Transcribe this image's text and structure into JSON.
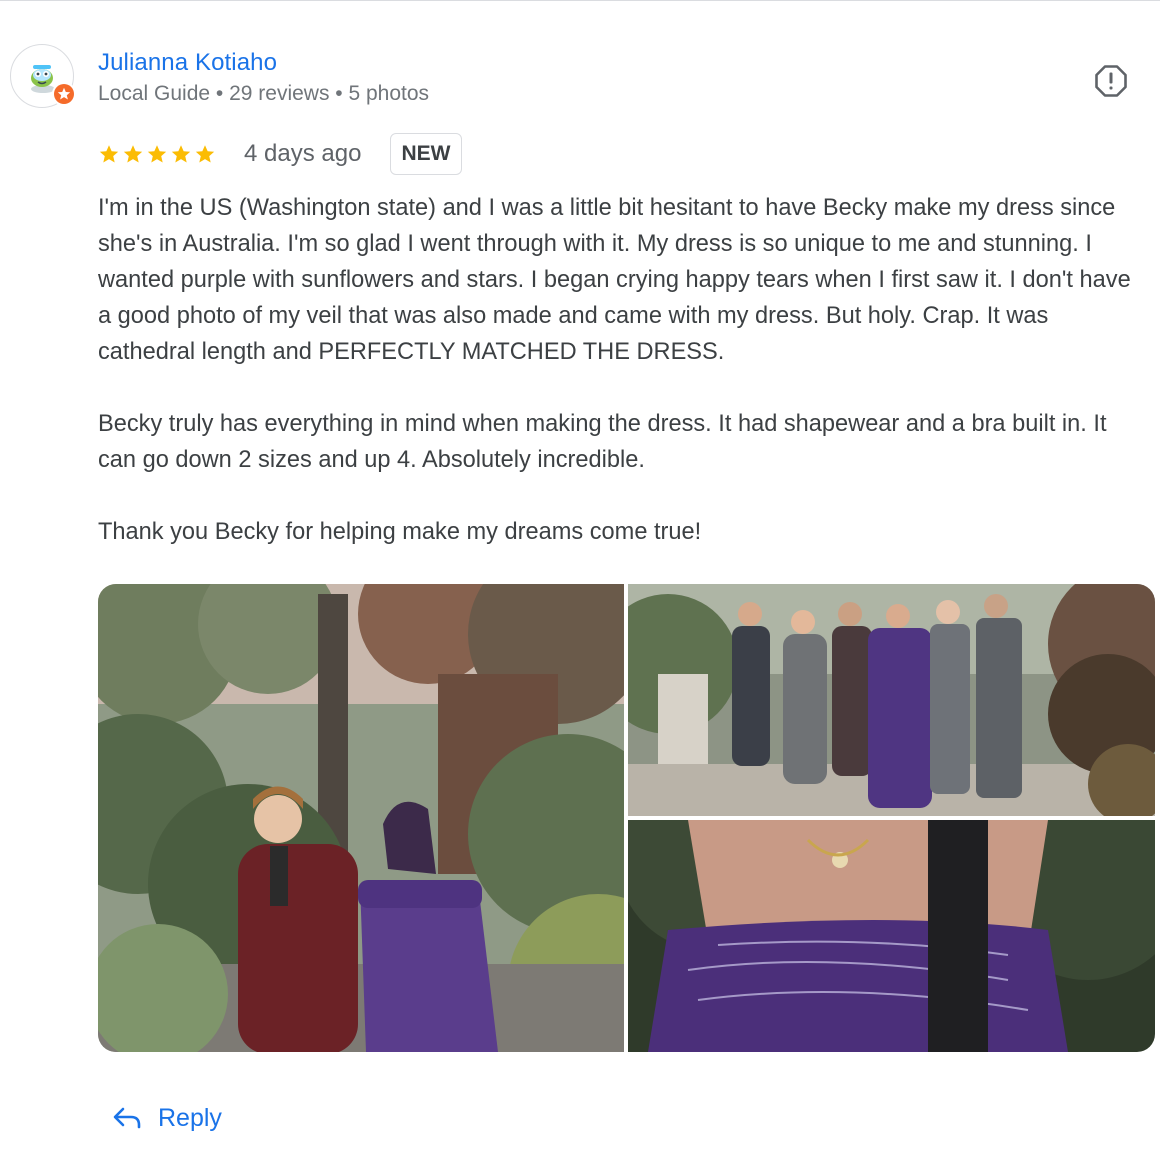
{
  "review": {
    "author": {
      "name": "Julianna Kotiaho",
      "meta": "Local Guide • 29 reviews • 5 photos",
      "avatar_icon": "cartoon-character-avatar",
      "badge_icon": "local-guide-star-badge"
    },
    "rating": {
      "stars": 5,
      "max": 5,
      "star_color": "#fbbc04"
    },
    "date": "4 days ago",
    "badge": "NEW",
    "paragraphs": [
      "I'm in the US (Washington state) and I was a little bit hesitant to have Becky make my dress since she's in Australia. I'm so glad I went through with it. My dress is so unique to me and stunning. I wanted purple with sunflowers and stars. I began crying happy tears when I first saw it. I don't have a good photo of my veil that was also made and came with my dress. But holy. Crap. It was cathedral length and PERFECTLY MATCHED THE DRESS.",
      "Becky truly has everything in mind when making the dress. It had shapewear and a bra built in. It can go down 2 sizes and up 4. Absolutely incredible.",
      "Thank you Becky for helping make my dreams come true!"
    ],
    "report_icon": "report-flag-icon",
    "photos": [
      {
        "subject": "couple-walking-in-garden"
      },
      {
        "subject": "group-photo-in-garden"
      },
      {
        "subject": "purple-dress-closeup"
      }
    ],
    "reply_label": "Reply",
    "reply_icon": "reply-arrow-icon",
    "accent_color": "#1a73e8"
  }
}
